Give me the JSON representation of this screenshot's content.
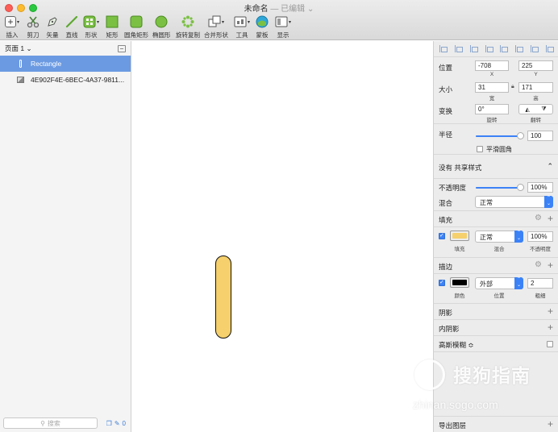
{
  "window": {
    "title": "未命名",
    "subtitle": "— 已编辑",
    "title_caret": "⌄"
  },
  "toolbar": [
    {
      "label": "插入",
      "icon": "insert-plus-icon",
      "dropdown": true
    },
    {
      "label": "剪刀",
      "icon": "scissors-icon"
    },
    {
      "label": "矢量",
      "icon": "pen-vector-icon"
    },
    {
      "label": "直线",
      "icon": "line-icon"
    },
    {
      "label": "形状",
      "icon": "shapes-icon",
      "dropdown": true
    },
    {
      "label": "矩形",
      "icon": "rectangle-icon"
    },
    {
      "label": "圆角矩形",
      "icon": "rounded-rectangle-icon"
    },
    {
      "label": "椭圆形",
      "icon": "oval-icon"
    },
    {
      "label": "旋转复制",
      "icon": "rotate-copy-icon"
    },
    {
      "label": "合并形状",
      "icon": "combine-shapes-icon",
      "dropdown": true
    },
    {
      "label": "工具",
      "icon": "tools-icon",
      "dropdown": true
    },
    {
      "label": "蒙板",
      "icon": "mask-icon"
    },
    {
      "label": "显示",
      "icon": "view-icon",
      "dropdown": true
    }
  ],
  "sidebar": {
    "page_label": "页面 1",
    "layers": [
      {
        "name": "Rectangle",
        "selected": true,
        "icon": "rectangle-layer-icon"
      },
      {
        "name": "4E902F4E-6BEC-4A37-9811...",
        "selected": false,
        "icon": "image-layer-icon"
      }
    ],
    "search_placeholder": "搜索",
    "layer_count": "0"
  },
  "inspector": {
    "position": {
      "label": "位置",
      "x": "-708",
      "y": "225",
      "x_cap": "X",
      "y_cap": "Y"
    },
    "size": {
      "label": "大小",
      "w": "31",
      "h": "171",
      "w_cap": "宽",
      "h_cap": "高"
    },
    "transform": {
      "label": "变换",
      "rotate": "0°",
      "rotate_cap": "旋转",
      "flip_cap": "翻转"
    },
    "radius": {
      "label": "半径",
      "value": "100",
      "slider": 1.0,
      "smooth_label": "平滑圆角",
      "smooth_checked": false
    },
    "shared_style": {
      "label": "没有 共享样式"
    },
    "opacity": {
      "label": "不透明度",
      "value": "100%",
      "slider": 1.0
    },
    "blend": {
      "label": "混合",
      "value": "正常"
    },
    "fill": {
      "header": "填充",
      "enabled": true,
      "color": "#F5D06C",
      "blend": "正常",
      "opacity": "100%",
      "cap_color": "填充",
      "cap_blend": "混合",
      "cap_opacity": "不透明度"
    },
    "border": {
      "header": "描边",
      "enabled": true,
      "color": "#000000",
      "position": "外部",
      "thickness": "2",
      "cap_color": "颜色",
      "cap_position": "位置",
      "cap_thickness": "粗细"
    },
    "shadow_header": "阴影",
    "inner_shadow_header": "内阴影",
    "gaussian_blur_header": "高斯模糊 ≎",
    "export_label": "导出图层"
  },
  "canvas": {
    "shape_fill": "#F5D06C",
    "shape_stroke": "#111111"
  },
  "watermark": {
    "text": "搜狗指南",
    "url": "zhinan.sogo.com"
  }
}
